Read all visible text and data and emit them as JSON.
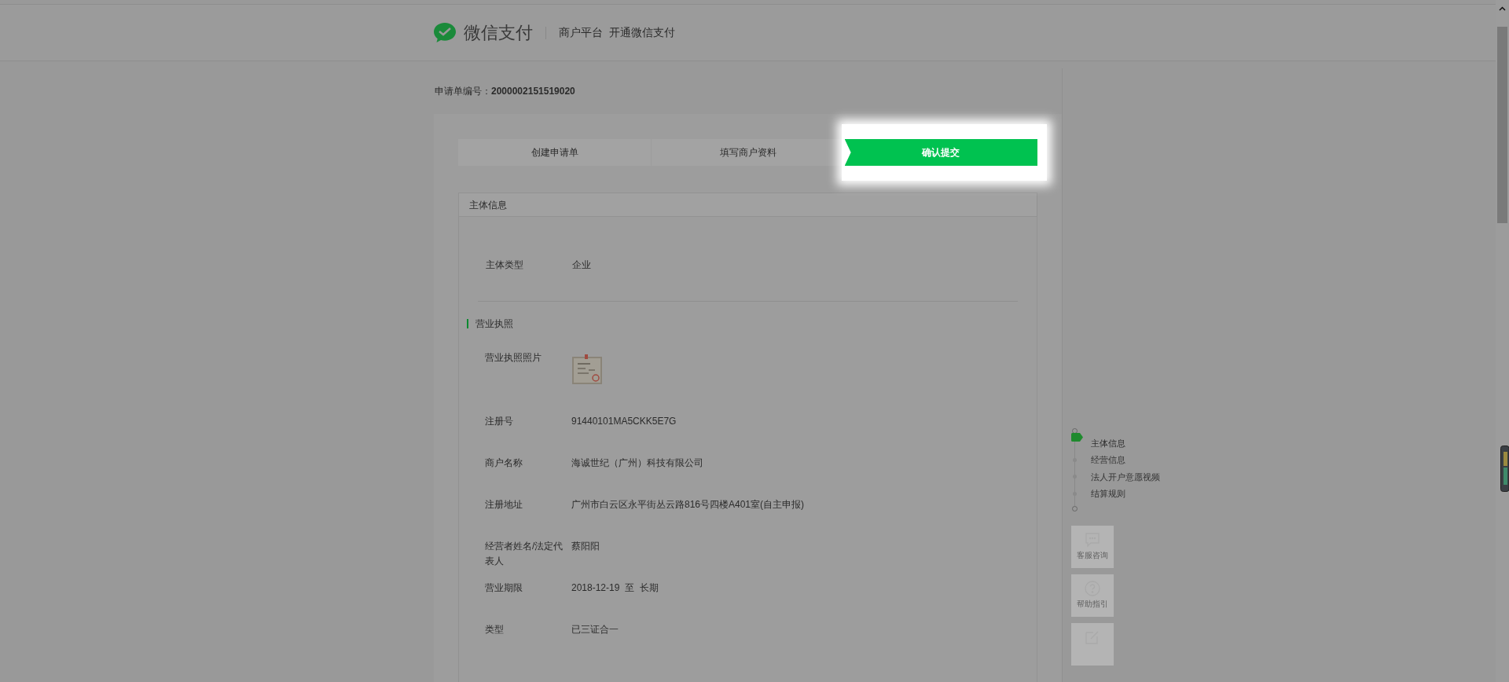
{
  "header": {
    "logo_text": "微信支付",
    "nav": [
      "商户平台",
      "开通微信支付"
    ]
  },
  "application": {
    "label": "申请单编号：",
    "number": "2000002151519020"
  },
  "steps": [
    {
      "label": "创建申请单",
      "selected": false
    },
    {
      "label": "填写商户资料",
      "selected": false
    },
    {
      "label": "确认提交",
      "selected": true
    }
  ],
  "section": {
    "title": "主体信息",
    "subject_type": {
      "label": "主体类型",
      "value": "企业"
    },
    "subsection": "营业执照",
    "fields": [
      {
        "label": "营业执照照片"
      },
      {
        "kind": "text",
        "label": "注册号",
        "value": "91440101MA5CKK5E7G"
      },
      {
        "kind": "text",
        "label": "商户名称",
        "value": "海诚世纪（广州）科技有限公司"
      },
      {
        "kind": "text",
        "label": "注册地址",
        "value": "广州市白云区永平街丛云路816号四楼A401室(自主申报)"
      },
      {
        "kind": "text",
        "label": "经营者姓名/法定代表人",
        "value": "蔡阳阳"
      },
      {
        "kind": "text",
        "label": "营业期限",
        "value": "2018-12-19  至  长期"
      },
      {
        "kind": "text",
        "label": "类型",
        "value": "已三证合一"
      }
    ]
  },
  "side_nav": [
    {
      "label": "主体信息",
      "selected": true
    },
    {
      "label": "经营信息",
      "selected": false
    },
    {
      "label": "法人开户意愿视频",
      "selected": false
    },
    {
      "label": "结算规则",
      "selected": false
    }
  ],
  "side_tools": [
    {
      "kind": "chat",
      "label": "客服咨询"
    },
    {
      "kind": "help",
      "label": "帮助指引"
    },
    {
      "kind": "edit"
    }
  ]
}
